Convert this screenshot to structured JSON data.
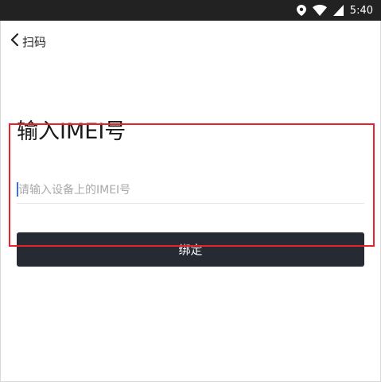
{
  "status_bar": {
    "time": "5:40",
    "icons": [
      "location-icon",
      "wifi-icon",
      "signal-icon"
    ]
  },
  "nav": {
    "back_label": "扫码",
    "back_icon": "chevron-left-icon"
  },
  "page": {
    "title": "输入IMEI号"
  },
  "imei_input": {
    "value": "",
    "placeholder": "请输入设备上的IMEI号"
  },
  "bind_button": {
    "label": "绑定"
  },
  "colors": {
    "status_bar_bg": "#222222",
    "button_bg": "#262a33",
    "highlight_border": "#e8212a",
    "caret": "#3a6df0"
  }
}
